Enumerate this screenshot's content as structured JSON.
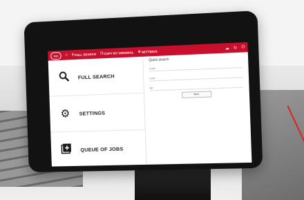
{
  "topbar": {
    "logo_text": "fcm",
    "items": [
      {
        "label": "FULL SEARCH",
        "icon": "search-icon"
      },
      {
        "label": "COPY BY ORIGINAL",
        "icon": "copy-icon"
      },
      {
        "label": "SETTINGS",
        "icon": "gear-icon"
      }
    ],
    "right_icons": [
      "cloud-icon",
      "sync-icon",
      "power-icon"
    ],
    "accent_color": "#c8102e"
  },
  "menu": [
    {
      "label": "FULL SEARCH",
      "icon": "search-icon"
    },
    {
      "label": "SETTINGS",
      "icon": "gear-icon"
    },
    {
      "label": "QUEUE OF JOBS",
      "icon": "queue-add-icon"
    }
  ],
  "quick_search": {
    "title": "Quick search",
    "fields": [
      {
        "label": "Code"
      },
      {
        "label": "Card"
      },
      {
        "label": "Bit"
      }
    ],
    "next_label": "Next"
  }
}
